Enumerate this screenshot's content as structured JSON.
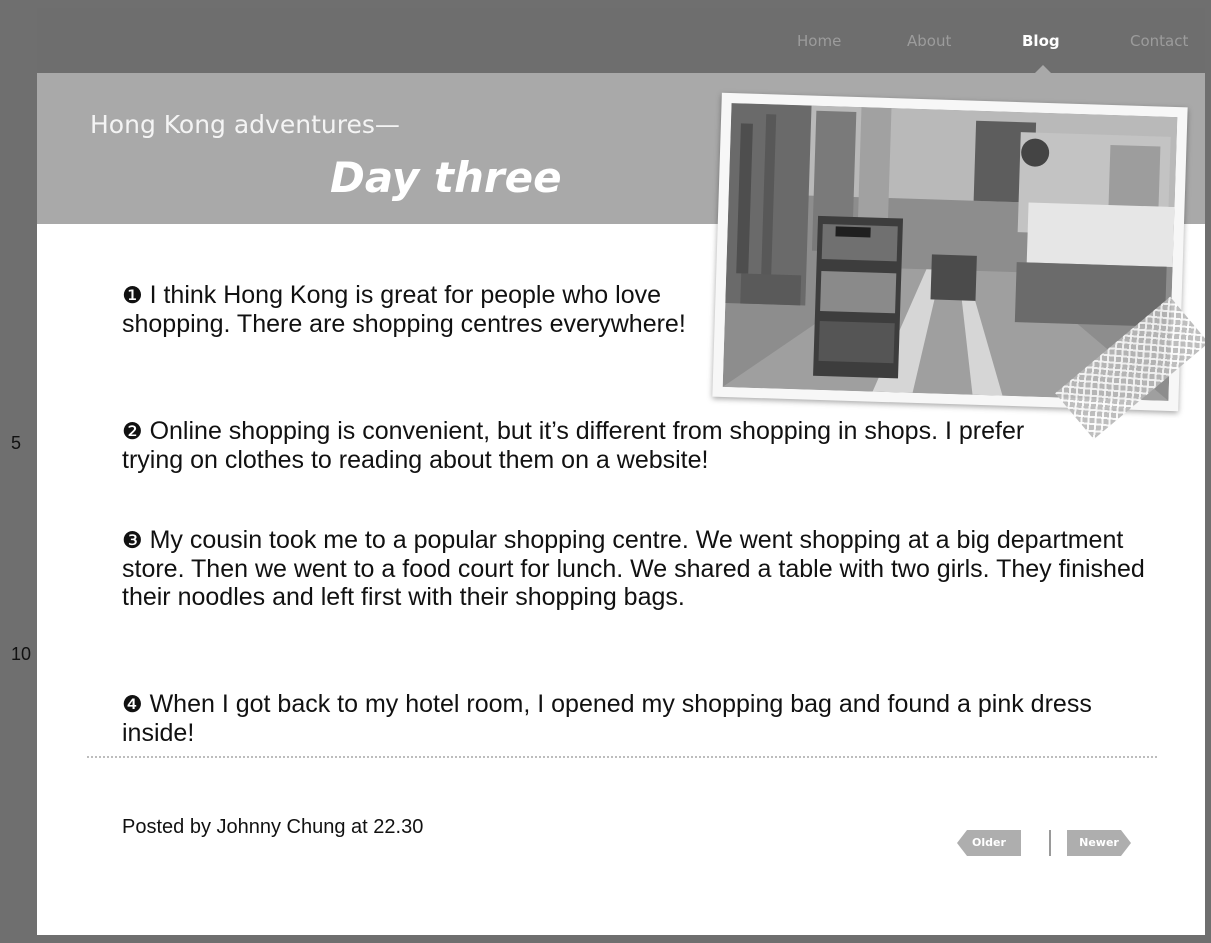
{
  "nav": {
    "items": [
      {
        "label": "Home"
      },
      {
        "label": "About"
      },
      {
        "label": "Blog"
      },
      {
        "label": "Contact"
      }
    ],
    "active": "Blog"
  },
  "header": {
    "line1": "Hong Kong adventures—",
    "line2": "Day three"
  },
  "photo": {
    "icon": "street-photo-icon"
  },
  "post": {
    "paragraphs": [
      {
        "num": "❶",
        "text": "I think Hong Kong is great for people who love shopping. There are shopping centres everywhere!"
      },
      {
        "num": "❷",
        "text": "Online shopping is convenient, but it’s different from shopping in shops. I prefer trying on clothes to reading about them on a website!"
      },
      {
        "num": "❸",
        "text": "My cousin took me to a popular shopping centre. We went shopping at a big department store. Then we went to a food court for lunch. We shared a table with two girls. They finished their noodles and left first with their shopping bags."
      },
      {
        "num": "❹",
        "text": "When I got back to my hotel room, I opened my shopping bag and found a pink dress inside!"
      }
    ],
    "line_numbers": [
      "5",
      "10"
    ],
    "posted_by": "Posted by Johnny Chung at 22.30"
  },
  "pager": {
    "older": "Older",
    "newer": "Newer"
  },
  "colors": {
    "nav_bg": "#6e6e6e",
    "header_bg": "#a9a9a9",
    "pager_bg": "#aeaeae"
  }
}
